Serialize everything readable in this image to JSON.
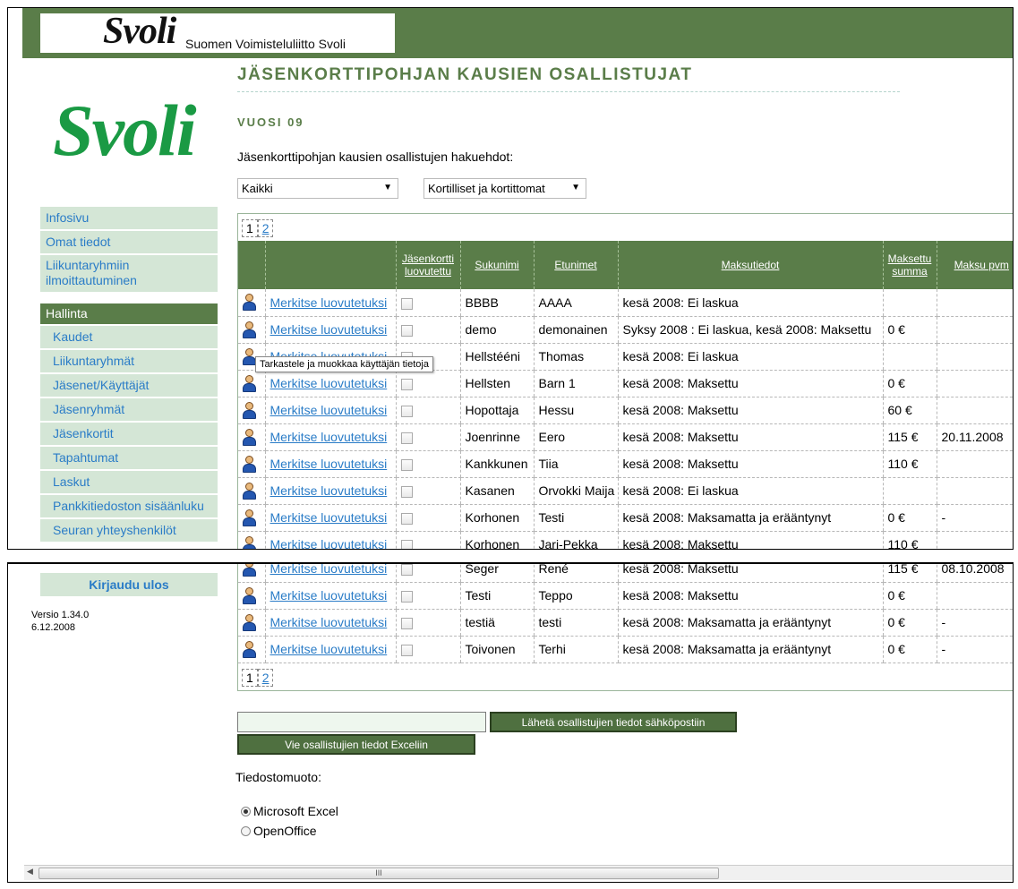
{
  "header": {
    "logo": "Svoli",
    "org_name": "Suomen Voimisteluliitto Svoli"
  },
  "sidebar": {
    "logo": "Svoli",
    "items": [
      "Infosivu",
      "Omat tiedot",
      "Liikuntaryhmiin ilmoittautuminen"
    ],
    "section": "Hallinta",
    "sub_items": [
      "Kaudet",
      "Liikuntaryhmät",
      "Jäsenet/Käyttäjät",
      "Jäsenryhmät",
      "Jäsenkortit",
      "Tapahtumat",
      "Laskut",
      "Pankkitiedoston sisäänluku",
      "Seuran yhteyshenkilöt"
    ],
    "logout": "Kirjaudu ulos",
    "version": "Versio 1.34.0",
    "date": "6.12.2008"
  },
  "main": {
    "title": "JÄSENKORTTIPOHJAN KAUSIEN OSALLISTUJAT",
    "year": "VUOSI 09",
    "intro": "Jäsenkorttipohjan kausien osallistujen hakuehdot:",
    "filter1": "Kaikki",
    "filter2": "Kortilliset ja kortittomat",
    "pages": [
      "1",
      "2"
    ],
    "tooltip": "Tarkastele ja muokkaa käyttäjän tietoja",
    "columns": {
      "card": "Jäsenkortti luovutettu",
      "surname": "Sukunimi",
      "firstname": "Etunimet",
      "payment": "Maksutiedot",
      "paid": "Maksettu summa",
      "paydate": "Maksu pvm"
    },
    "link_label": "Merkitse luovutetuksi",
    "rows_top": [
      {
        "surname": "BBBB",
        "firstname": "AAAA",
        "payment": "kesä 2008: Ei laskua",
        "paid": "",
        "paydate": ""
      },
      {
        "surname": "demo",
        "firstname": "demonainen",
        "payment": "Syksy 2008 : Ei laskua, kesä 2008: Maksettu",
        "paid": "0 €",
        "paydate": ""
      },
      {
        "surname": "Hellstééni",
        "firstname": "Thomas",
        "payment": "kesä 2008: Ei laskua",
        "paid": "",
        "paydate": ""
      },
      {
        "surname": "Hellsten",
        "firstname": "Barn 1",
        "payment": "kesä 2008: Maksettu",
        "paid": "0 €",
        "paydate": ""
      },
      {
        "surname": "Hopottaja",
        "firstname": "Hessu",
        "payment": "kesä 2008: Maksettu",
        "paid": "60 €",
        "paydate": ""
      },
      {
        "surname": "Joenrinne",
        "firstname": "Eero",
        "payment": "kesä 2008: Maksettu",
        "paid": "115 €",
        "paydate": "20.11.2008"
      },
      {
        "surname": "Kankkunen",
        "firstname": "Tiia",
        "payment": "kesä 2008: Maksettu",
        "paid": "110 €",
        "paydate": ""
      },
      {
        "surname": "Kasanen",
        "firstname": "Orvokki Maija",
        "payment": "kesä 2008: Ei laskua",
        "paid": "",
        "paydate": ""
      },
      {
        "surname": "Korhonen",
        "firstname": "Testi",
        "payment": "kesä 2008: Maksamatta ja erääntynyt",
        "paid": "0 €",
        "paydate": "-"
      },
      {
        "surname": "Korhonen",
        "firstname": "Jari-Pekka",
        "payment": "kesä 2008: Maksettu",
        "paid": "110 €",
        "paydate": ""
      }
    ],
    "rows_bottom": [
      {
        "surname": "Seger",
        "firstname": "René",
        "payment": "kesä 2008: Maksettu",
        "paid": "115 €",
        "paydate": "08.10.2008"
      },
      {
        "surname": "Testi",
        "firstname": "Teppo",
        "payment": "kesä 2008: Maksettu",
        "paid": "0 €",
        "paydate": ""
      },
      {
        "surname": "testiä",
        "firstname": "testi",
        "payment": "kesä 2008: Maksamatta ja erääntynyt",
        "paid": "0 €",
        "paydate": "-"
      },
      {
        "surname": "Toivonen",
        "firstname": "Terhi",
        "payment": "kesä 2008: Maksamatta ja erääntynyt",
        "paid": "0 €",
        "paydate": "-"
      }
    ],
    "email_value": "",
    "send_button": "Lähetä osallistujien tiedot sähköpostiin",
    "excel_button": "Vie osallistujien tiedot Exceliin",
    "format_label": "Tiedostomuoto:",
    "format_options": [
      "Microsoft Excel",
      "OpenOffice"
    ],
    "format_selected": "Microsoft Excel",
    "scroll_grip": "III"
  },
  "colors": {
    "brand_green": "#5a7d49",
    "logo_green": "#1a9a44",
    "nav_bg": "#d4e6d6",
    "link_blue": "#2a7cc7"
  }
}
